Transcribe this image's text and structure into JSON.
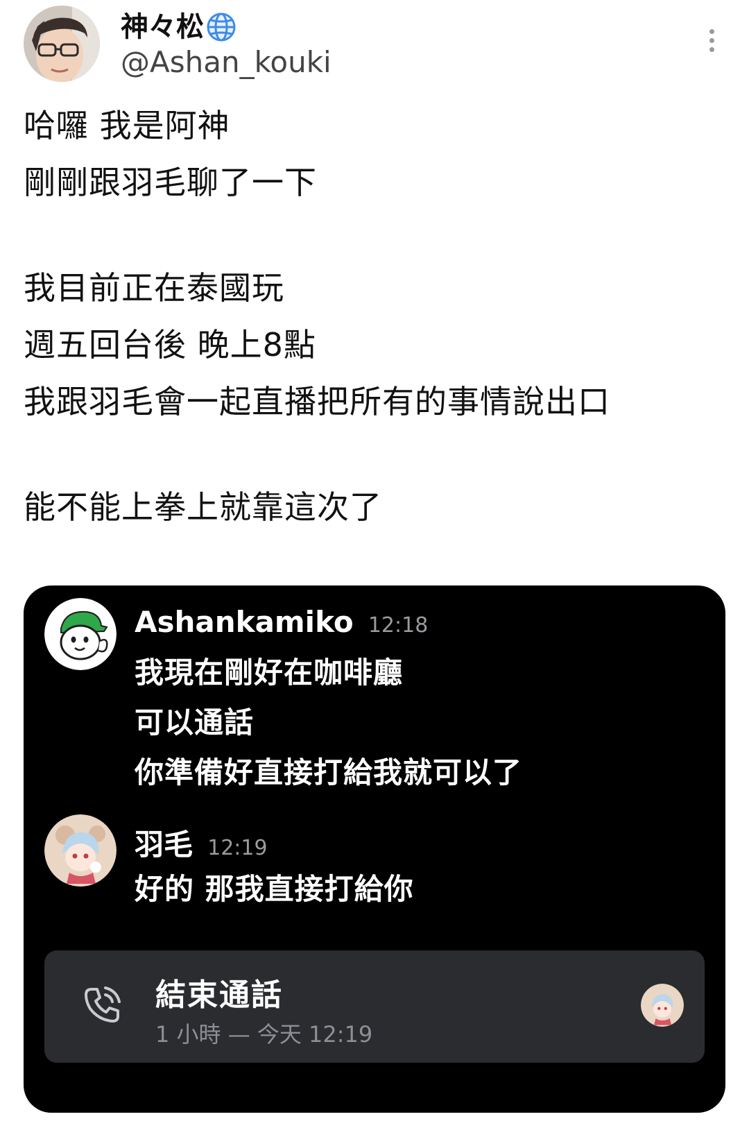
{
  "author": {
    "display_name": "神々松",
    "handle": "@Ashan_kouki",
    "badge_icon": "globe-icon"
  },
  "tweet": {
    "lines": [
      "哈囉 我是阿神",
      "剛剛跟羽毛聊了一下",
      "",
      "我目前正在泰國玩",
      "週五回台後 晚上8點",
      "我跟羽毛會一起直播把所有的事情說出口",
      "",
      "能不能上拳上就靠這次了"
    ]
  },
  "screenshot": {
    "messages": [
      {
        "author": "Ashankamiko",
        "time": "12:18",
        "lines": [
          "我現在剛好在咖啡廳",
          "可以通話",
          "你準備好直接打給我就可以了"
        ]
      },
      {
        "author": "羽毛",
        "time": "12:19",
        "lines": [
          "好的 那我直接打給你"
        ]
      }
    ],
    "call": {
      "title": "結束通話",
      "subtitle": "1 小時 — 今天 12:19",
      "icon": "phone-call-icon"
    }
  },
  "colors": {
    "card_background": "#000000",
    "call_card_background": "#2b2c30",
    "globe_blue": "#3d8be8"
  }
}
